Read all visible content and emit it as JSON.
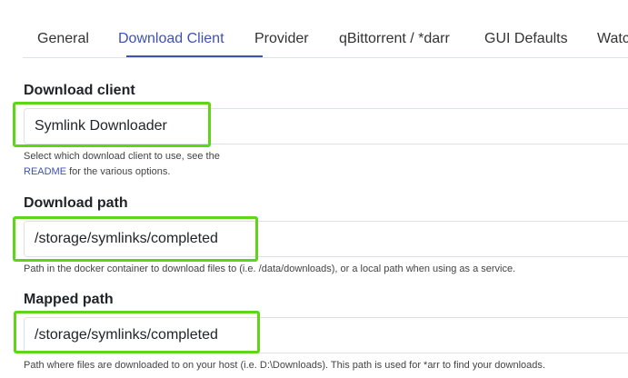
{
  "tabs": [
    {
      "label": "General"
    },
    {
      "label": "Download Client",
      "active": true
    },
    {
      "label": "Provider"
    },
    {
      "label": "qBittorrent / *darr"
    },
    {
      "label": "GUI Defaults"
    },
    {
      "label": "Watc"
    }
  ],
  "download_client": {
    "label": "Download client",
    "value": "Symlink Downloader",
    "help_line1": "Select which download client to use, see the",
    "help_link": "README",
    "help_line2_rest": " for the various options."
  },
  "download_path": {
    "label": "Download path",
    "value": "/storage/symlinks/completed",
    "help": "Path in the docker container to download files to (i.e. /data/downloads), or a local path when using as a service."
  },
  "mapped_path": {
    "label": "Mapped path",
    "value": "/storage/symlinks/completed",
    "help": "Path where files are downloaded to on your host (i.e. D:\\Downloads). This path is used for *arr to find your downloads."
  },
  "colors": {
    "accent": "#3f51b5",
    "highlight": "#5fd51a"
  }
}
